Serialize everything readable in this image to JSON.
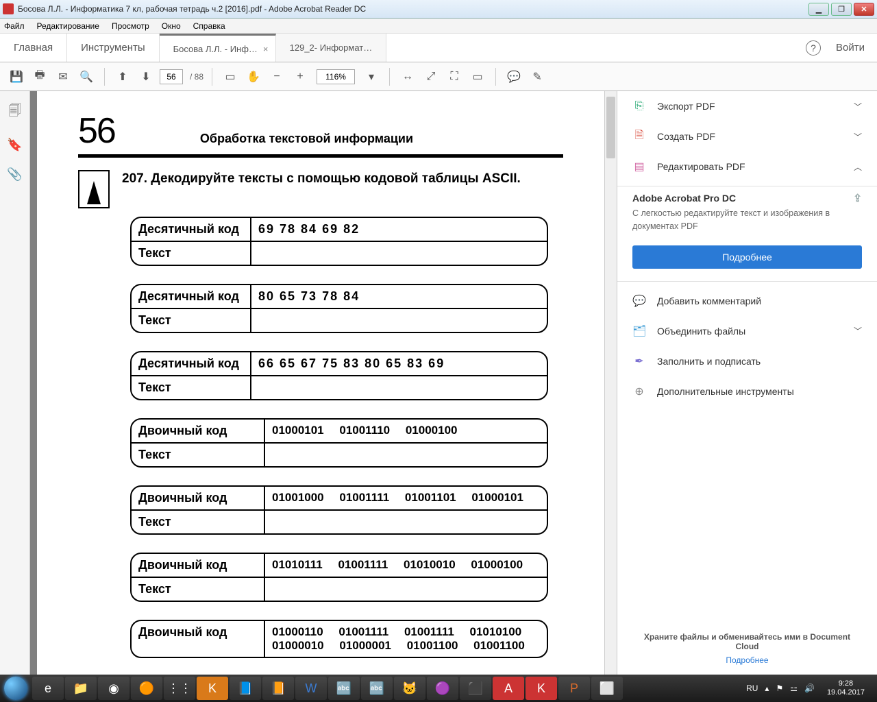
{
  "window": {
    "title": "Босова Л.Л. - Информатика 7 кл, рабочая тетрадь ч.2 [2016].pdf - Adobe Acrobat Reader DC",
    "minimize": "▁",
    "maximize": "❐",
    "close": "✕"
  },
  "menubar": [
    "Файл",
    "Редактирование",
    "Просмотр",
    "Окно",
    "Справка"
  ],
  "uppertabs": {
    "home": "Главная",
    "tools": "Инструменты",
    "docs": [
      {
        "label": "Босова Л.Л. - Инф…",
        "active": true
      },
      {
        "label": "129_2- Информат…",
        "active": false
      }
    ],
    "help": "?",
    "login": "Войти"
  },
  "toolbar": {
    "page_current": "56",
    "page_total": "/ 88",
    "zoom": "116%"
  },
  "doc": {
    "page_number": "56",
    "chapter": "Обработка текстовой информации",
    "task_number": "207.",
    "task_text": "Декодируйте тексты с помощью кодовой таблицы ASCII.",
    "label_dec": "Десятичный код",
    "label_bin": "Двоичный код",
    "label_text": "Текст",
    "tables": [
      {
        "type": "dec",
        "code": "69  78  84  69  82"
      },
      {
        "type": "dec",
        "code": "80  65  73  78  84"
      },
      {
        "type": "dec",
        "code": "66  65  67  75  83  80  65  83  69"
      },
      {
        "type": "bin",
        "code": "01000101 01001110 01000100"
      },
      {
        "type": "bin",
        "code": "01001000 01001111 01001101 01000101"
      },
      {
        "type": "bin",
        "code": "01010111 01001111 01010010 01000100"
      },
      {
        "type": "bin",
        "code": "01000110 01001111 01001111 01010100\n01000010 01000001 01001100 01001100"
      }
    ]
  },
  "rightpanel": {
    "export": "Экспорт PDF",
    "create": "Создать PDF",
    "edit": "Редактировать PDF",
    "pro_title": "Adobe Acrobat Pro DC",
    "pro_sub": "С легкостью редактируйте текст и изображения в документах PDF",
    "more_btn": "Подробнее",
    "comment": "Добавить комментарий",
    "combine": "Объединить файлы",
    "fillsign": "Заполнить и подписать",
    "moretools": "Дополнительные инструменты",
    "footer1": "Храните файлы и обменивайтесь ими в Document Cloud",
    "footer_link": "Подробнее"
  },
  "tray": {
    "lang": "RU",
    "time": "9:28",
    "date": "19.04.2017"
  }
}
